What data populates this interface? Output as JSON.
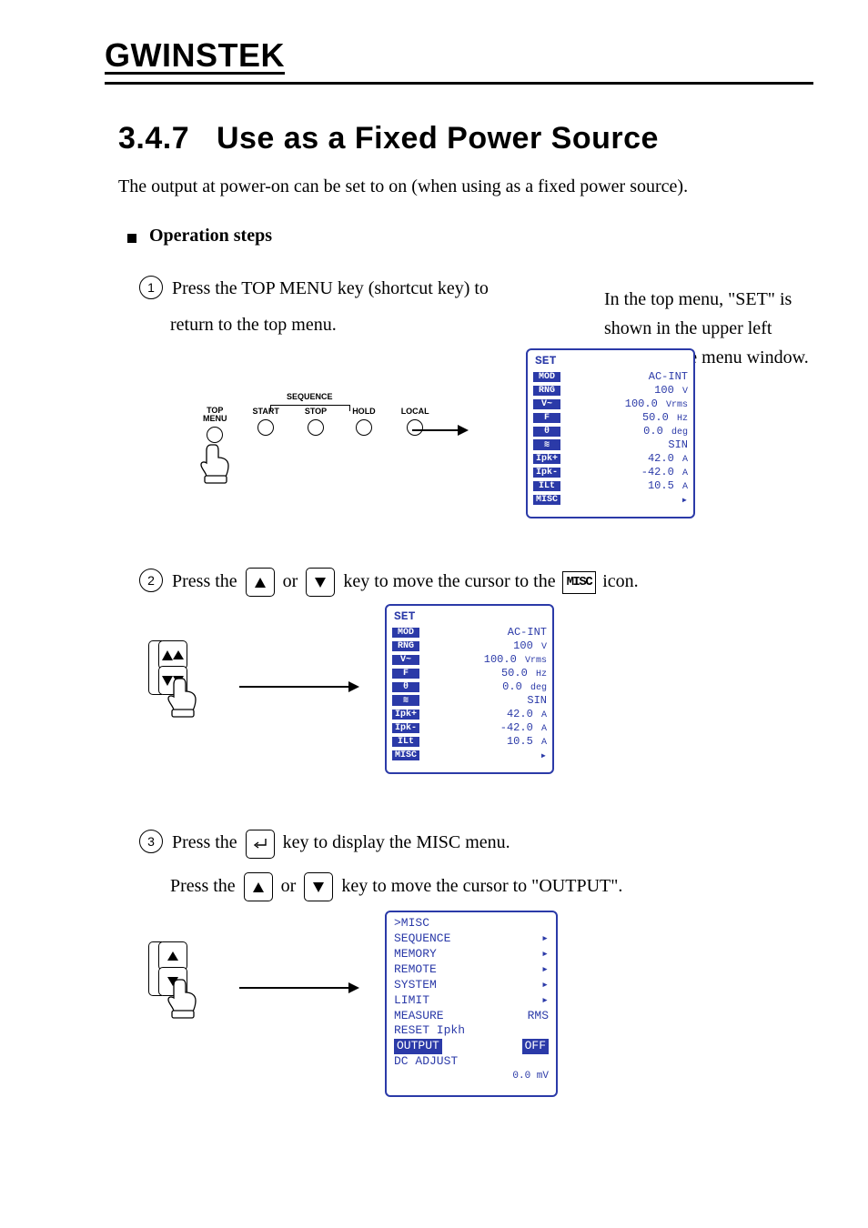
{
  "brand": "GWINSTEK",
  "section_number": "3.4.7",
  "section_title": "Use as a Fixed Power Source",
  "intro": "The output at power-on can be set to on (when using as a fixed power source).",
  "bullet": "Operation steps",
  "step1_num": "1",
  "step1_text_a": "Press the TOP MENU key (shortcut key) to",
  "step1_text_b": "return to the top menu.",
  "step1_text_c": "In the top menu, \"SET\" is shown in the upper left corner of the menu window.",
  "step2_num": "2",
  "step2_text_a": "Press the",
  "step2_text_b": "or",
  "step2_text_c": "key to move the cursor to the",
  "step2_text_d": "icon.",
  "misc_literal": "MISC",
  "step3_num": "3",
  "step3_text_a": "Press the",
  "step3_text_b": "key to display the MISC menu.",
  "step3_text_c": "Press the",
  "step3_text_d": "or",
  "step3_text_e": "key to move the cursor to \"OUTPUT\".",
  "panel": {
    "top_menu": "TOP\nMENU",
    "start": "START",
    "stop": "STOP",
    "hold": "HOLD",
    "local": "LOCAL",
    "sequence": "SEQUENCE"
  },
  "set_screen": {
    "title": "SET",
    "rows": [
      {
        "tag": "MOD",
        "val": "AC-INT",
        "unit": ""
      },
      {
        "tag": "RNG",
        "val": "100",
        "unit": "V"
      },
      {
        "tag": "V~",
        "val": "100.0",
        "unit": "Vrms"
      },
      {
        "tag": "F",
        "val": "50.0",
        "unit": "Hz"
      },
      {
        "tag": "θ",
        "val": "0.0",
        "unit": "deg"
      },
      {
        "tag": "≋",
        "val": "SIN",
        "unit": ""
      },
      {
        "tag": "Ipk+",
        "val": "42.0",
        "unit": "A"
      },
      {
        "tag": "Ipk-",
        "val": "-42.0",
        "unit": "A"
      },
      {
        "tag": "ILt",
        "val": "10.5",
        "unit": "A"
      }
    ],
    "misc_tag": "MISC"
  },
  "misc_screen": {
    "title": ">MISC",
    "items": [
      {
        "label": "SEQUENCE",
        "right": "▸"
      },
      {
        "label": "MEMORY",
        "right": "▸"
      },
      {
        "label": "REMOTE",
        "right": "▸"
      },
      {
        "label": "SYSTEM",
        "right": "▸"
      },
      {
        "label": "LIMIT",
        "right": "▸"
      },
      {
        "label": "MEASURE",
        "right": "RMS"
      },
      {
        "label": "RESET Ipkh",
        "right": ""
      }
    ],
    "selected": {
      "label": "OUTPUT",
      "right": "OFF"
    },
    "dcadj_label": "DC ADJUST",
    "dcadj_val": "0.0 mV"
  }
}
